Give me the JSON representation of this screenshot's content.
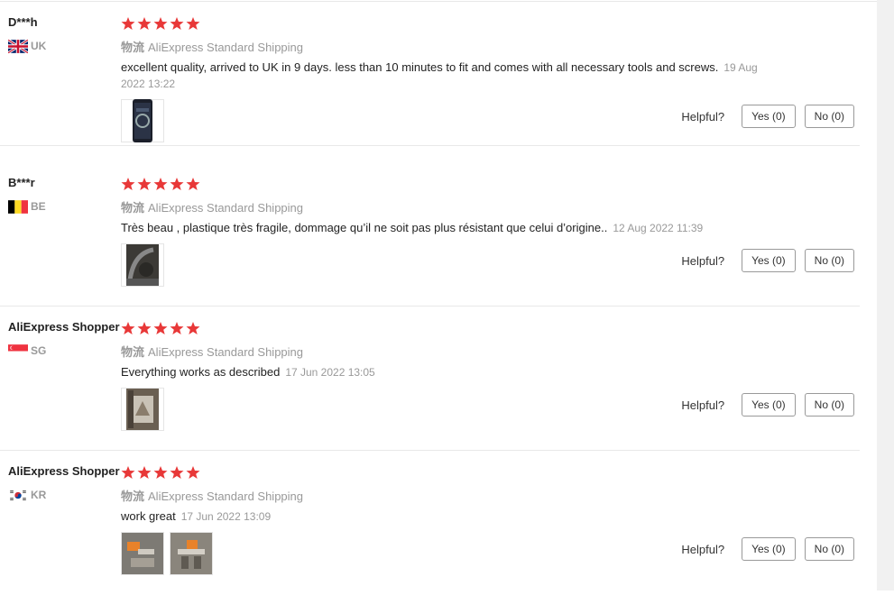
{
  "colors": {
    "star": "#e83838",
    "muted": "#999999",
    "divider": "#e8e8e8"
  },
  "helpful_label": "Helpful?",
  "shipping_prefix": "物流",
  "reviews": [
    {
      "user": "D***h",
      "country": "UK",
      "flag": "uk-flag-icon",
      "stars": 5,
      "shipping": "AliExpress Standard Shipping",
      "text": "excellent quality, arrived to UK in 9 days. less than 10 minutes to fit and comes with all necessary tools and screws.",
      "date": "19 Aug 2022 13:22",
      "yes": "Yes (0)",
      "no": "No (0)",
      "photos": [
        "photo-steering-wheel-cover"
      ]
    },
    {
      "user": "B***r",
      "country": "BE",
      "flag": "be-flag-icon",
      "stars": 5,
      "shipping": "AliExpress Standard Shipping",
      "text": "Très beau , plastique très fragile, dommage qu’il ne soit pas plus résistant que celui d’origine..",
      "date": "12 Aug 2022 11:39",
      "yes": "Yes (0)",
      "no": "No (0)",
      "photos": [
        "photo-installed-part"
      ]
    },
    {
      "user": "AliExpress Shopper",
      "country": "SG",
      "flag": "sg-flag-icon",
      "stars": 5,
      "shipping": "AliExpress Standard Shipping",
      "text": "Everything works as described",
      "date": "17 Jun 2022 13:05",
      "yes": "Yes (0)",
      "no": "No (0)",
      "photos": [
        "photo-car-interior"
      ]
    },
    {
      "user": "AliExpress Shopper",
      "country": "KR",
      "flag": "kr-flag-icon",
      "stars": 5,
      "shipping": "AliExpress Standard Shipping",
      "text": "work great",
      "date": "17 Jun 2022 13:09",
      "yes": "Yes (0)",
      "no": "No (0)",
      "photos": [
        "photo-orange-parts-1",
        "photo-orange-parts-2"
      ]
    }
  ]
}
